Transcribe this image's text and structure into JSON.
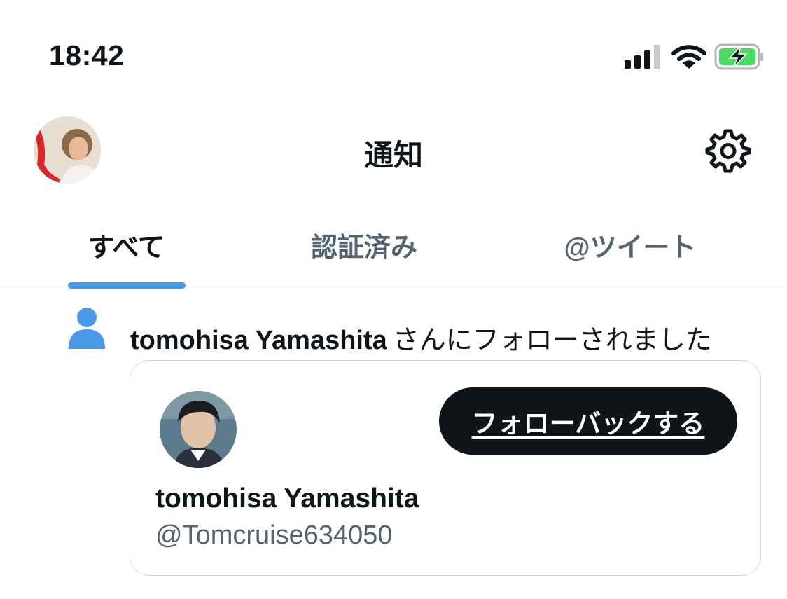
{
  "status_bar": {
    "time": "18:42",
    "icons": [
      "cellular-signal-icon",
      "wifi-icon",
      "battery-charging-icon"
    ],
    "battery_color": "#4cd964"
  },
  "header": {
    "title": "通知",
    "avatar": "profile-avatar",
    "settings_icon": "gear-icon"
  },
  "tabs": [
    {
      "label": "すべて",
      "active": true
    },
    {
      "label": "認証済み",
      "active": false
    },
    {
      "label": "@ツイート",
      "active": false
    }
  ],
  "notification": {
    "icon": "person-icon",
    "actor_name": "tomohisa Yamashita",
    "action_text": "さんにフォローされました",
    "card": {
      "follow_back_label": "フォローバックする",
      "display_name": "tomohisa Yamashita",
      "handle": "@Tomcruise634050"
    }
  },
  "colors": {
    "accent": "#4a99e9",
    "text_primary": "#0f1419",
    "text_secondary": "#536471",
    "divider": "#cfd9de"
  }
}
